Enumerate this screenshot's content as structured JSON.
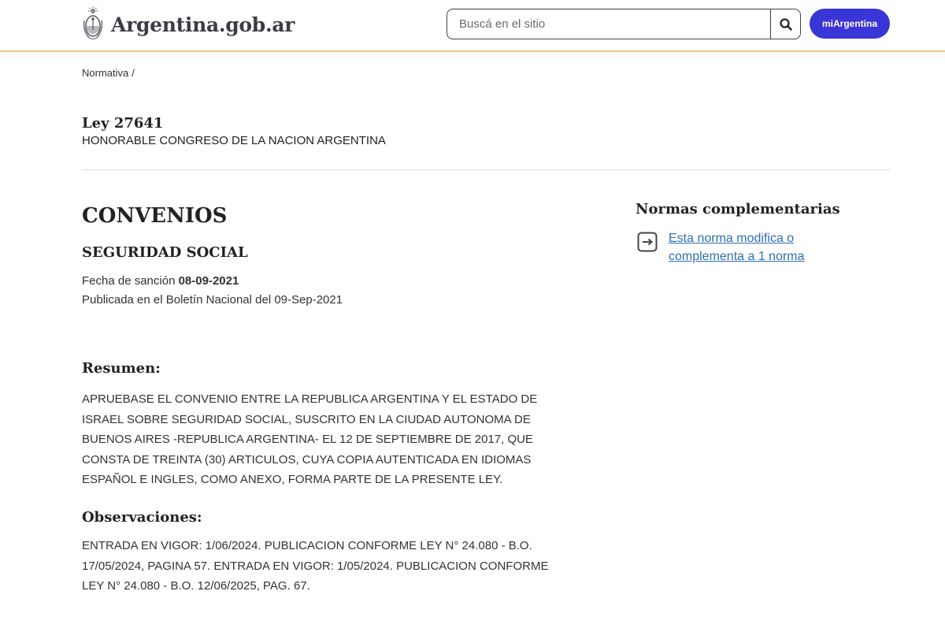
{
  "header": {
    "logo_text": "Argentina.gob.ar",
    "search_placeholder": "Buscá en el sitio",
    "mi_button": "miArgentina"
  },
  "breadcrumb": {
    "items": [
      "Normativa"
    ],
    "separator": "/"
  },
  "law": {
    "title": "Ley 27641",
    "organism": "HONORABLE CONGRESO DE LA NACION ARGENTINA"
  },
  "main": {
    "title": "CONVENIOS",
    "subtitle": "SEGURIDAD SOCIAL",
    "fecha_label": "Fecha de sanción",
    "fecha_value": "08-09-2021",
    "publicada": "Publicada en el Boletín Nacional del 09-Sep-2021",
    "resumen_heading": "Resumen:",
    "resumen_lines": [
      "APRUEBASE EL CONVENIO ENTRE LA REPUBLICA ARGENTINA Y EL ESTADO DE",
      "ISRAEL SOBRE SEGURIDAD SOCIAL, SUSCRITO EN LA CIUDAD AUTONOMA DE",
      "BUENOS AIRES -REPUBLICA ARGENTINA- EL 12 DE SEPTIEMBRE DE 2017, QUE",
      "CONSTA DE TREINTA (30) ARTICULOS, CUYA COPIA AUTENTICADA EN IDIOMAS",
      "ESPAÑOL E INGLES, COMO ANEXO, FORMA PARTE DE LA PRESENTE LEY."
    ],
    "observaciones_heading": "Observaciones:",
    "observaciones_lines": [
      "ENTRADA EN VIGOR: 1/06/2024. PUBLICACION CONFORME LEY N° 24.080 - B.O.",
      "17/05/2024, PAGINA 57. ENTRADA EN VIGOR: 1/05/2024. PUBLICACION CONFORME",
      "LEY N° 24.080 - B.O. 12/06/2025, PAG. 67."
    ]
  },
  "aside": {
    "title": "Normas complementarias",
    "link_line1": "Esta norma modifica o",
    "link_line2": "complementa a 1 norma",
    "link_icon": "arrow-right-box-icon"
  },
  "colors": {
    "header_border": "#e8c77c",
    "brand_button": "#3a35d6",
    "link": "#2f6fb3"
  }
}
